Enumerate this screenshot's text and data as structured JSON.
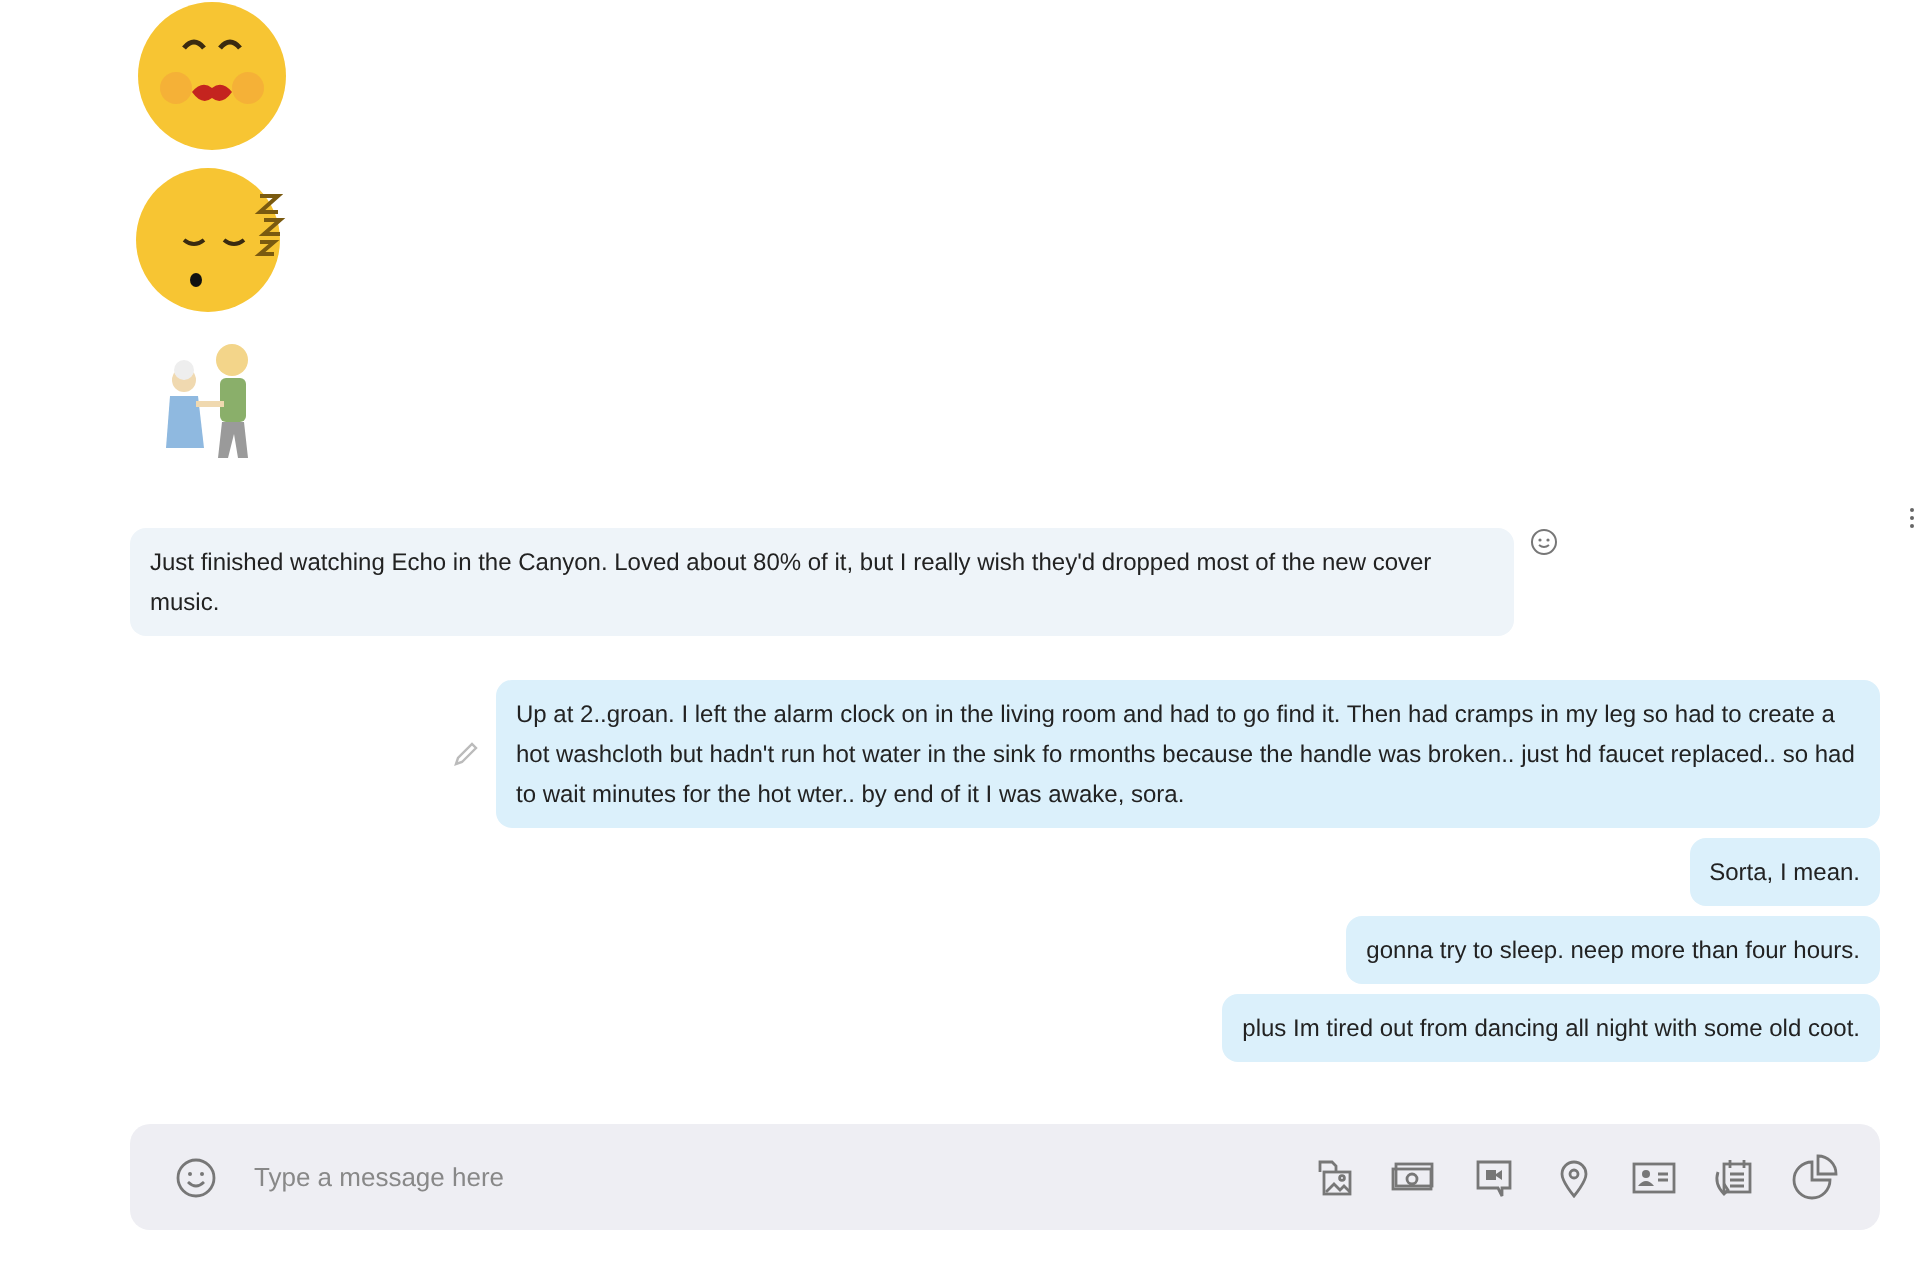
{
  "messages": [
    {
      "kind": "kiss-emoji"
    },
    {
      "kind": "sleep-emoji"
    },
    {
      "kind": "sticker"
    },
    {
      "kind": "incoming-text",
      "text": "Just finished watching Echo in the Canyon. Loved about 80% of it, but I really wish they'd dropped most of the new cover music."
    },
    {
      "kind": "outgoing-text",
      "edited": true,
      "text": "Up at 2..groan. I left the alarm clock on in the living room and had to go find it. Then had cramps in my leg so had to create a hot washcloth but hadn't run hot water in the sink fo rmonths because the handle was broken.. just hd faucet replaced.. so had to wait minutes for the hot wter.. by end of it I was awake, sora."
    },
    {
      "kind": "outgoing-text",
      "text": "Sorta, I mean."
    },
    {
      "kind": "outgoing-text",
      "text": "gonna try to sleep. neep more than four hours."
    },
    {
      "kind": "outgoing-text",
      "text": "plus Im tired out from dancing all night with some old coot."
    }
  ],
  "composer": {
    "placeholder": "Type a message here"
  }
}
